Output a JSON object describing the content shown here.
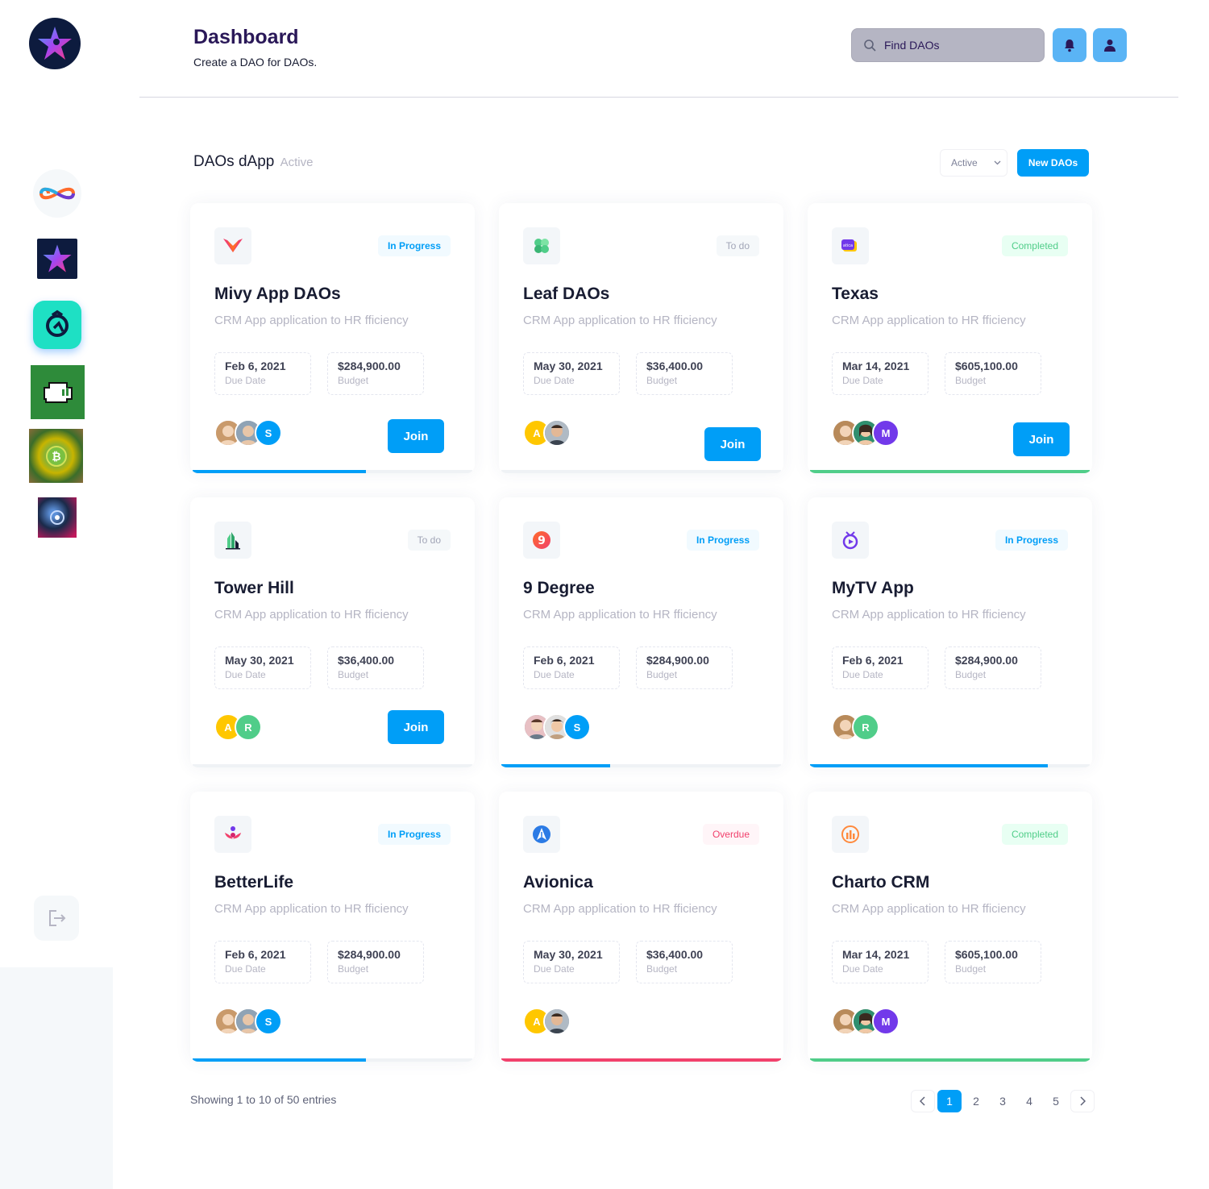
{
  "header": {
    "title": "Dashboard",
    "subtitle": "Create a DAO for DAOs.",
    "search_placeholder": "Find DAOs"
  },
  "sidebar": {
    "items": [
      {
        "name": "infinity-app-icon"
      },
      {
        "name": "star-app-icon"
      },
      {
        "name": "compass-app-icon"
      },
      {
        "name": "pixel-cloud-app-icon"
      },
      {
        "name": "bitcoin-flower-app-icon"
      },
      {
        "name": "galaxy-app-icon"
      }
    ]
  },
  "section": {
    "title": "DAOs dApp",
    "status": "Active",
    "filter_value": "Active",
    "new_button": "New DAOs"
  },
  "cards": [
    {
      "title": "Mivy App  DAOs",
      "desc": "CRM App application to HR fficiency",
      "status": "In Progress",
      "due": "Feb 6, 2021",
      "due_label": "Due Date",
      "budget": "$284,900.00",
      "budget_label": "Budget",
      "join": "Join",
      "progress": 0.62,
      "avatars": [
        "",
        "",
        "S"
      ]
    },
    {
      "title": "Leaf DAOs",
      "desc": "CRM App application to HR fficiency",
      "status": "To do",
      "due": "May 30, 2021",
      "due_label": "Due Date",
      "budget": "$36,400.00",
      "budget_label": "Budget",
      "join": "Join",
      "progress": 0,
      "avatars": [
        "A",
        ""
      ]
    },
    {
      "title": "Texas",
      "desc": "CRM App application to HR fficiency",
      "status": "Completed",
      "due": "Mar 14, 2021",
      "due_label": "Due Date",
      "budget": "$605,100.00",
      "budget_label": "Budget",
      "join": "Join",
      "progress": 1,
      "avatars": [
        "",
        "",
        "M"
      ]
    },
    {
      "title": "Tower Hill",
      "desc": "CRM App application to HR fficiency",
      "status": "To do",
      "due": "May 30, 2021",
      "due_label": "Due Date",
      "budget": "$36,400.00",
      "budget_label": "Budget",
      "join": "Join",
      "progress": 0,
      "avatars": [
        "A",
        "R"
      ]
    },
    {
      "title": "9 Degree",
      "desc": "CRM App application to HR fficiency",
      "status": "In Progress",
      "due": "Feb 6, 2021",
      "due_label": "Due Date",
      "budget": "$284,900.00",
      "budget_label": "Budget",
      "progress": 0.39,
      "avatars": [
        "",
        "",
        "S"
      ]
    },
    {
      "title": "MyTV App",
      "desc": "CRM App application to HR fficiency",
      "status": "In Progress",
      "due": "Feb 6, 2021",
      "due_label": "Due Date",
      "budget": "$284,900.00",
      "budget_label": "Budget",
      "progress": 0.85,
      "avatars": [
        "",
        "R"
      ]
    },
    {
      "title": "BetterLife",
      "desc": "CRM App application to HR fficiency",
      "status": "In Progress",
      "due": "Feb 6, 2021",
      "due_label": "Due Date",
      "budget": "$284,900.00",
      "budget_label": "Budget",
      "progress": 0.62,
      "avatars": [
        "",
        "",
        "S"
      ]
    },
    {
      "title": "Avionica",
      "desc": "CRM App application to HR fficiency",
      "status": "Overdue",
      "due": "May 30, 2021",
      "due_label": "Due Date",
      "budget": "$36,400.00",
      "budget_label": "Budget",
      "progress": 1,
      "avatars": [
        "A",
        ""
      ]
    },
    {
      "title": "Charto CRM",
      "desc": "CRM App application to HR fficiency",
      "status": "Completed",
      "due": "Mar 14, 2021",
      "due_label": "Due Date",
      "budget": "$605,100.00",
      "budget_label": "Budget",
      "progress": 1,
      "avatars": [
        "",
        "",
        "M"
      ]
    }
  ],
  "colors": {
    "primary": "#009ef7",
    "success": "#50cd89",
    "danger": "#f1416c",
    "header_title": "#2a1858"
  },
  "footer": {
    "entries_text": "Showing 1 to 10 of 50 entries",
    "pages": [
      "1",
      "2",
      "3",
      "4",
      "5"
    ],
    "current_page": "1"
  }
}
